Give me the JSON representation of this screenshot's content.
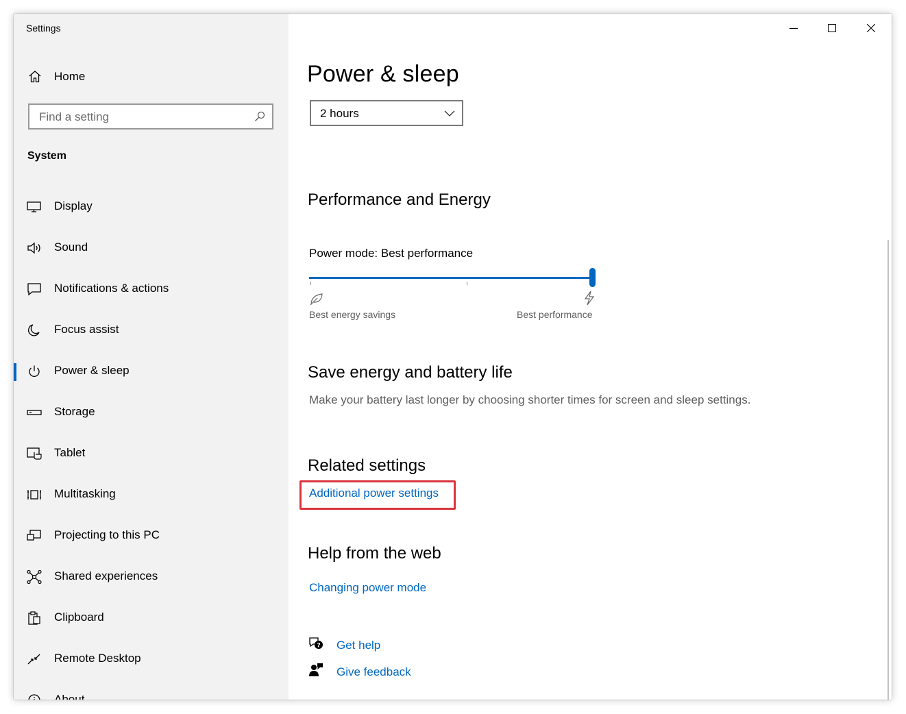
{
  "window": {
    "title": "Settings"
  },
  "sidebar": {
    "home_label": "Home",
    "search_placeholder": "Find a setting",
    "section": "System",
    "items": [
      {
        "label": "Display",
        "icon": "display-icon"
      },
      {
        "label": "Sound",
        "icon": "speaker-icon"
      },
      {
        "label": "Notifications & actions",
        "icon": "notification-icon"
      },
      {
        "label": "Focus assist",
        "icon": "moon-icon"
      },
      {
        "label": "Power & sleep",
        "icon": "power-icon",
        "active": true
      },
      {
        "label": "Storage",
        "icon": "storage-icon"
      },
      {
        "label": "Tablet",
        "icon": "tablet-icon"
      },
      {
        "label": "Multitasking",
        "icon": "multitasking-icon"
      },
      {
        "label": "Projecting to this PC",
        "icon": "projecting-icon"
      },
      {
        "label": "Shared experiences",
        "icon": "shared-experiences-icon"
      },
      {
        "label": "Clipboard",
        "icon": "clipboard-icon"
      },
      {
        "label": "Remote Desktop",
        "icon": "remote-desktop-icon"
      },
      {
        "label": "About",
        "icon": "info-icon"
      }
    ]
  },
  "main": {
    "title": "Power & sleep",
    "sleep_dropdown_value": "2 hours",
    "performance": {
      "heading": "Performance and Energy",
      "mode_label": "Power mode: Best performance",
      "slider_value": 1.0,
      "left_caption": "Best energy savings",
      "right_caption": "Best performance"
    },
    "save_energy": {
      "heading": "Save energy and battery life",
      "description": "Make your battery last longer by choosing shorter times for screen and sleep settings."
    },
    "related": {
      "heading": "Related settings",
      "link": "Additional power settings",
      "highlight_color": "#d9353b"
    },
    "help": {
      "heading": "Help from the web",
      "link": "Changing power mode"
    },
    "footer": {
      "get_help": "Get help",
      "give_feedback": "Give feedback"
    }
  },
  "colors": {
    "accent": "#0067c0",
    "sidebar_bg": "#f2f2f2"
  }
}
